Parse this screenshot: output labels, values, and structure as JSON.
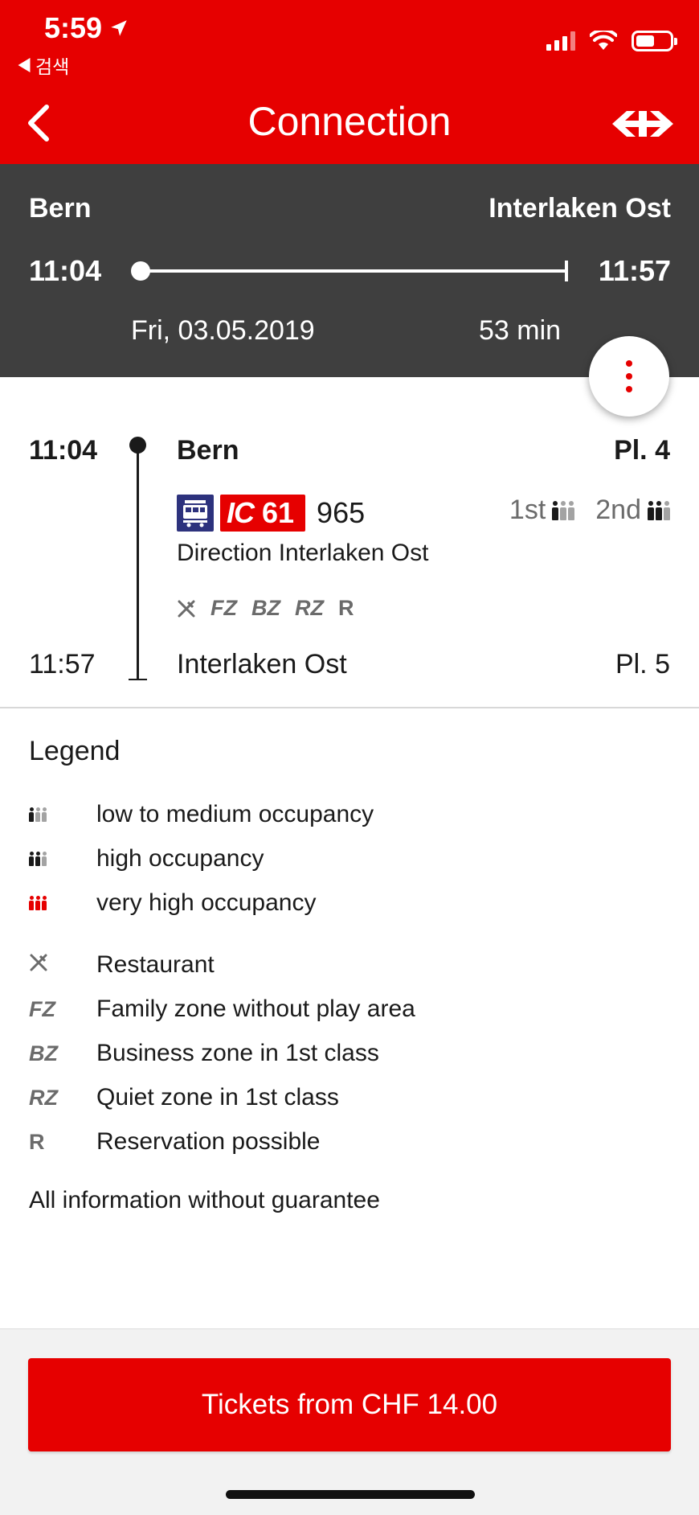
{
  "status_bar": {
    "time": "5:59",
    "back_label": "검색"
  },
  "nav": {
    "title": "Connection"
  },
  "summary": {
    "from": "Bern",
    "to": "Interlaken Ost",
    "departure": "11:04",
    "arrival": "11:57",
    "date": "Fri, 03.05.2019",
    "duration": "53 min"
  },
  "section": {
    "departure_time": "11:04",
    "departure_station": "Bern",
    "departure_platform": "Pl. 4",
    "line_category": "IC",
    "line_number": "61",
    "train_number": "965",
    "direction": "Direction Interlaken Ost",
    "occupancy": {
      "first_label": "1st",
      "second_label": "2nd",
      "first_level": "low to medium",
      "second_level": "high"
    },
    "features": [
      "FZ",
      "BZ",
      "RZ",
      "R"
    ],
    "arrival_time": "11:57",
    "arrival_station": "Interlaken Ost",
    "arrival_platform": "Pl. 5"
  },
  "legend": {
    "title": "Legend",
    "occupancy_items": [
      {
        "text": "low to medium occupancy"
      },
      {
        "text": "high occupancy"
      },
      {
        "text": "very high occupancy"
      }
    ],
    "feature_items": [
      {
        "symbol": "",
        "text": "Restaurant"
      },
      {
        "symbol": "FZ",
        "text": "Family zone without play area"
      },
      {
        "symbol": "BZ",
        "text": "Business zone in 1st class"
      },
      {
        "symbol": "RZ",
        "text": "Quiet zone in 1st class"
      },
      {
        "symbol": "R",
        "text": "Reservation possible"
      }
    ],
    "disclaimer": "All information without guarantee"
  },
  "footer": {
    "ticket_button": "Tickets from CHF 14.00"
  },
  "colors": {
    "brand_red": "#e60000",
    "summary_bg": "#3f3f3f",
    "train_icon_blue": "#2d327d"
  }
}
